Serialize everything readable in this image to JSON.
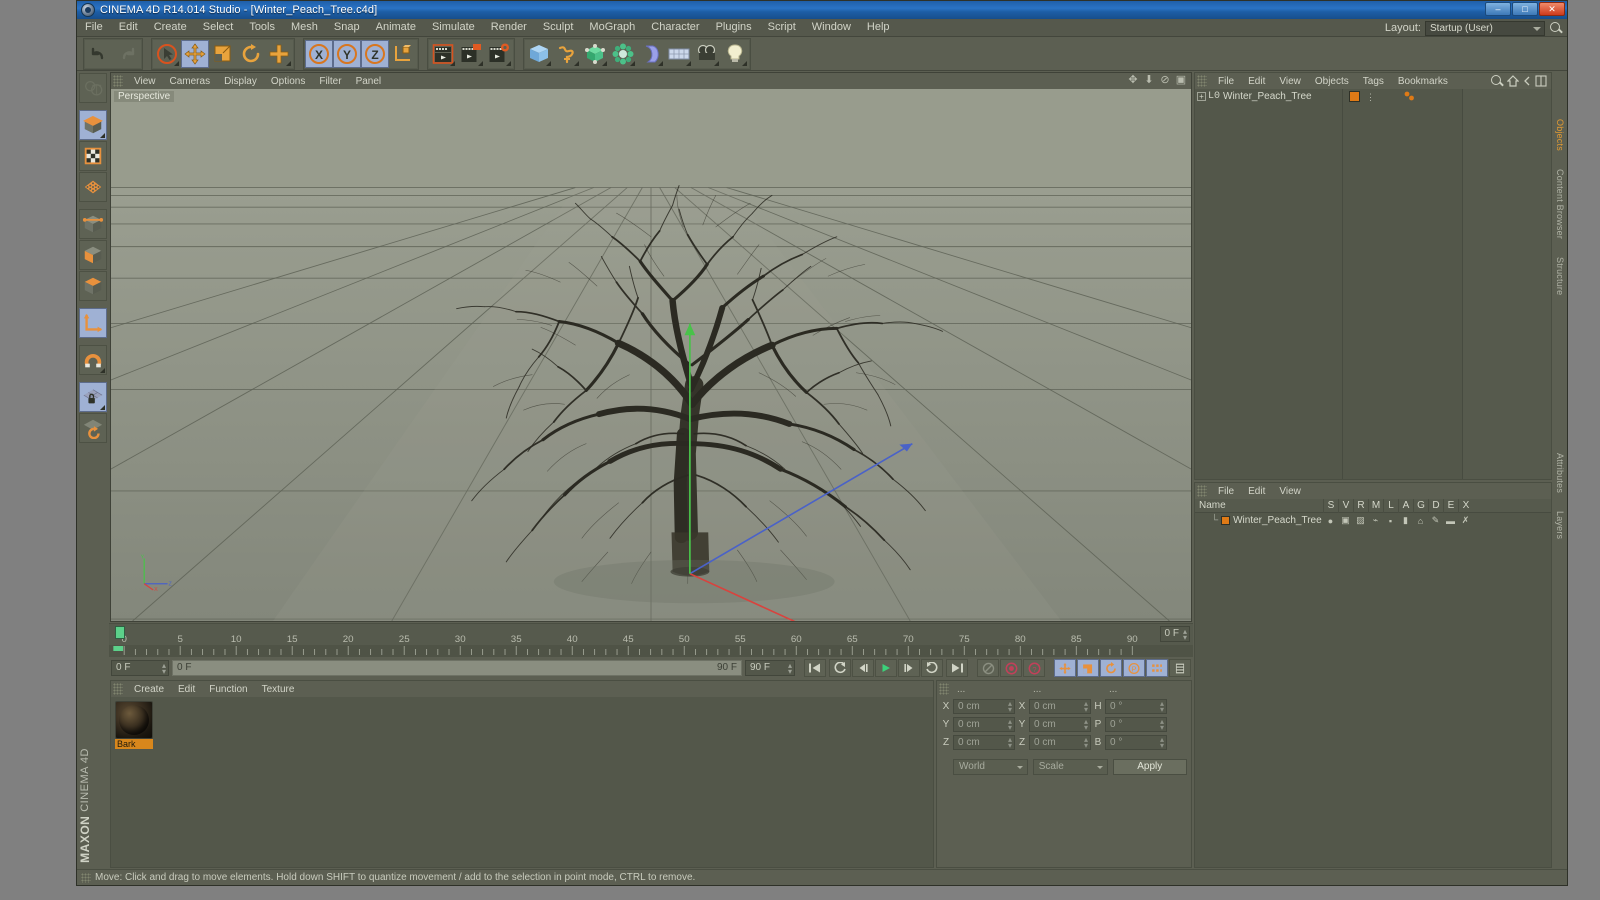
{
  "window": {
    "title": "CINEMA 4D R14.014 Studio - [Winter_Peach_Tree.c4d]",
    "app_icon": "c4d-logo-icon",
    "minimize": "–",
    "maximize": "□",
    "close": "✕"
  },
  "menubar": {
    "items": [
      "File",
      "Edit",
      "Create",
      "Select",
      "Tools",
      "Mesh",
      "Snap",
      "Animate",
      "Simulate",
      "Render",
      "Sculpt",
      "MoGraph",
      "Character",
      "Plugins",
      "Script",
      "Window",
      "Help"
    ],
    "layout_label": "Layout:",
    "layout_value": "Startup (User)",
    "search_icon": "search-icon"
  },
  "toolbar": {
    "groups": [
      {
        "name": "history",
        "buttons": [
          {
            "icon": "undo-icon",
            "glyph": "↶",
            "state": "normal",
            "color": "#3b3f35"
          },
          {
            "icon": "redo-icon",
            "glyph": "↷",
            "state": "disabled",
            "color": "#6d7163"
          }
        ]
      },
      {
        "name": "transform",
        "buttons": [
          {
            "icon": "live-selection-icon",
            "glyph": "◉",
            "state": "normal",
            "color": "#d86b2a"
          },
          {
            "icon": "move-tool-icon",
            "glyph": "✛",
            "state": "selected",
            "color": "#e8a33d"
          },
          {
            "icon": "scale-tool-icon",
            "glyph": "▣",
            "state": "normal",
            "color": "#e8a33d"
          },
          {
            "icon": "rotate-tool-icon",
            "glyph": "↻",
            "state": "normal",
            "color": "#e8a33d"
          },
          {
            "icon": "add-tool-icon",
            "glyph": "✛",
            "state": "normal",
            "color": "#e8a33d"
          }
        ]
      },
      {
        "name": "axis-lock",
        "buttons": [
          {
            "icon": "lock-x-axis-icon",
            "glyph": "X",
            "state": "selected",
            "color": "#2f3329"
          },
          {
            "icon": "lock-y-axis-icon",
            "glyph": "Y",
            "state": "selected",
            "color": "#2f3329"
          },
          {
            "icon": "lock-z-axis-icon",
            "glyph": "Z",
            "state": "selected",
            "color": "#2f3329"
          },
          {
            "icon": "world-object-coord-icon",
            "glyph": "⌐",
            "state": "normal",
            "color": "#e8a33d"
          }
        ]
      },
      {
        "name": "render",
        "buttons": [
          {
            "icon": "render-view-icon",
            "glyph": "▶",
            "state": "normal",
            "color": "#d8dacd"
          },
          {
            "icon": "render-region-icon",
            "glyph": "▶",
            "state": "normal",
            "color": "#d8dacd"
          },
          {
            "icon": "render-to-picture-viewer-icon",
            "glyph": "▶",
            "state": "normal",
            "color": "#d8dacd"
          },
          {
            "icon": "render-settings-icon",
            "glyph": "▶",
            "state": "normal",
            "color": "#d8dacd"
          }
        ]
      },
      {
        "name": "objects",
        "buttons": [
          {
            "icon": "cube-primitive-icon",
            "glyph": "▥",
            "state": "normal",
            "color": "#7fb8e8"
          },
          {
            "icon": "spline-pen-icon",
            "glyph": "∿",
            "state": "normal",
            "color": "#e8a33d"
          },
          {
            "icon": "subdivision-surface-icon",
            "glyph": "◈",
            "state": "normal",
            "color": "#52c98a"
          },
          {
            "icon": "array-generator-icon",
            "glyph": "❀",
            "state": "normal",
            "color": "#52c98a"
          },
          {
            "icon": "bend-deformer-icon",
            "glyph": "◗",
            "state": "normal",
            "color": "#9aa0e8"
          },
          {
            "icon": "floor-environment-icon",
            "glyph": "▤",
            "state": "normal",
            "color": "#c3cde8"
          },
          {
            "icon": "camera-icon",
            "glyph": "📷",
            "state": "normal",
            "color": "#3a3e34"
          },
          {
            "icon": "light-icon",
            "glyph": "💡",
            "state": "normal",
            "color": "#f2e9b0"
          }
        ]
      }
    ]
  },
  "left_toolbar": {
    "buttons": [
      {
        "name": "make-editable-icon",
        "glyph": "◎",
        "state": "disabled"
      },
      {
        "name": "model-mode-icon",
        "glyph": "▣",
        "state": "selected"
      },
      {
        "name": "texture-mode-icon",
        "glyph": "▦",
        "state": "normal"
      },
      {
        "name": "points-mode-icon",
        "glyph": "◈",
        "state": "normal"
      },
      {
        "name": "edges-mode-icon",
        "glyph": "⬡",
        "state": "normal"
      },
      {
        "name": "polygons-mode-icon",
        "glyph": "▰",
        "state": "normal"
      },
      {
        "name": "normal-move-icon",
        "glyph": "◆",
        "state": "normal"
      },
      {
        "name": "object-axis-mode-icon",
        "glyph": "L",
        "state": "selected"
      },
      {
        "name": "enable-snap-icon",
        "glyph": "U",
        "state": "normal"
      },
      {
        "name": "lock-workplane-icon",
        "glyph": "🔒",
        "state": "selected"
      },
      {
        "name": "workplane-rotate-icon",
        "glyph": "↻",
        "state": "normal"
      }
    ],
    "brand": "MAXON",
    "brand_sub": "CINEMA 4D"
  },
  "viewport": {
    "menu": [
      "View",
      "Cameras",
      "Display",
      "Options",
      "Filter",
      "Panel"
    ],
    "camera_label": "Perspective",
    "corner_icons": [
      "pan-view-icon",
      "dolly-view-icon",
      "rotate-view-icon",
      "maximize-view-icon"
    ],
    "scene_object": "Winter_Peach_Tree"
  },
  "timeline": {
    "start_frame_ticks": [
      "0",
      "5",
      "10",
      "15",
      "20",
      "25",
      "30",
      "35",
      "40",
      "45",
      "50",
      "55",
      "60",
      "65",
      "70",
      "75",
      "80",
      "85",
      "90"
    ],
    "current_frame_label": "0 F",
    "current_frame_field": "0 F",
    "range_start": "0 F",
    "range_end": "90 F",
    "end_field": "90 F",
    "playhead_frame": 0,
    "transport": [
      {
        "name": "go-to-start-button",
        "glyph": "⏮"
      },
      {
        "name": "go-to-previous-key-button",
        "glyph": "◖"
      },
      {
        "name": "go-to-previous-frame-button",
        "glyph": "◀|"
      },
      {
        "name": "play-button",
        "glyph": "▶"
      },
      {
        "name": "go-to-next-frame-button",
        "glyph": "|▶"
      },
      {
        "name": "go-to-next-key-button",
        "glyph": "◗"
      },
      {
        "name": "go-to-end-button",
        "glyph": "⏭"
      }
    ],
    "record_group": [
      {
        "name": "record-active-objects-button",
        "glyph": "⊘",
        "color": "#8a8e80"
      },
      {
        "name": "autokeying-button",
        "glyph": "◉",
        "color": "#c24a5e"
      },
      {
        "name": "keyframe-selection-button",
        "glyph": "?",
        "color": "#c24a5e"
      }
    ],
    "key_toggles": [
      {
        "name": "position-key-toggle",
        "glyph": "✛",
        "color": "#e8a33d",
        "active": true
      },
      {
        "name": "scale-key-toggle",
        "glyph": "▣",
        "color": "#e8a33d",
        "active": true
      },
      {
        "name": "rotation-key-toggle",
        "glyph": "↻",
        "color": "#e8a33d",
        "active": true
      },
      {
        "name": "parameter-key-toggle",
        "glyph": "P",
        "color": "#e8a33d",
        "active": true
      },
      {
        "name": "point-level-animation-toggle",
        "glyph": "⠿",
        "color": "#e8a33d",
        "active": true
      }
    ],
    "extra_button": {
      "name": "timeline-options-button",
      "glyph": "▤"
    }
  },
  "material_manager": {
    "menu": [
      "Create",
      "Edit",
      "Function",
      "Texture"
    ],
    "materials": [
      {
        "name": "Bark",
        "preview": "bark-texture-sphere"
      }
    ]
  },
  "coordinates": {
    "column_headers": [
      "...",
      "...",
      "..."
    ],
    "rows": [
      {
        "pos_axis": "X",
        "pos_value": "0 cm",
        "size_axis": "X",
        "size_value": "0 cm",
        "rot_axis": "H",
        "rot_value": "0 °"
      },
      {
        "pos_axis": "Y",
        "pos_value": "0 cm",
        "size_axis": "Y",
        "size_value": "0 cm",
        "rot_axis": "P",
        "rot_value": "0 °"
      },
      {
        "pos_axis": "Z",
        "pos_value": "0 cm",
        "size_axis": "Z",
        "size_value": "0 cm",
        "rot_axis": "B",
        "rot_value": "0 °"
      }
    ],
    "coord_system": "World",
    "size_mode": "Scale",
    "apply_label": "Apply"
  },
  "object_manager": {
    "menu": [
      "File",
      "Edit",
      "View",
      "Objects",
      "Tags",
      "Bookmarks"
    ],
    "header_icons": [
      "search-icon",
      "home-icon",
      "chevron-left-icon",
      "layout-icon"
    ],
    "objects": [
      {
        "name": "Winter_Peach_Tree",
        "expand": "+",
        "icon": "L0",
        "tag_color": "#df7a16",
        "has_material_tag": true
      }
    ]
  },
  "attribute_manager": {
    "menu": [
      "File",
      "Edit",
      "View"
    ],
    "columns": [
      "Name",
      "S",
      "V",
      "R",
      "M",
      "L",
      "A",
      "G",
      "D",
      "E",
      "X"
    ],
    "rows": [
      {
        "name": "Winter_Peach_Tree",
        "icons": [
          "●",
          "▣",
          "▨",
          "⌁",
          "▪",
          "▮",
          "⌂",
          "✎",
          "▬",
          "✗"
        ]
      }
    ]
  },
  "right_tabs": [
    {
      "label": "Objects",
      "accent": true
    },
    {
      "label": "Content Browser",
      "accent": false
    },
    {
      "label": "Structure",
      "accent": false
    },
    {
      "label": "Attributes",
      "accent": false
    },
    {
      "label": "Layers",
      "accent": false
    }
  ],
  "statusbar": {
    "text": "Move: Click and drag to move elements. Hold down SHIFT to quantize movement / add to the selection in point mode, CTRL to remove."
  },
  "colors": {
    "accent_orange": "#df7a16",
    "panel_bg": "#5c5f52",
    "panel_dark": "#53574a",
    "selected_blue": "#9fb1d4",
    "title_blue": "#2a73c4",
    "axis_x_red": "#d8433e",
    "axis_y_green": "#49c24a",
    "axis_z_blue": "#4a62c8"
  }
}
